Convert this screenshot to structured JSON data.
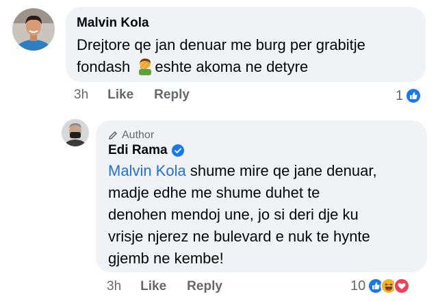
{
  "comment": {
    "author": "Malvin Kola",
    "text_line1": "Drejtore qe jan denuar me burg per grabitje",
    "text_line2_before": "fondash ",
    "text_line2_after": "eshte akoma ne detyre",
    "time": "3h",
    "like_label": "Like",
    "reply_label": "Reply",
    "reaction_count": "1",
    "reaction_icons": [
      "like-icon"
    ]
  },
  "reply": {
    "badge": "Author",
    "author": "Edi Rama",
    "mention": "Malvin Kola",
    "text_line1": " shume mire qe jane denuar,",
    "text_line2": "madje edhe me shume duhet te",
    "text_line3": "denohen mendoj une, jo si deri dje ku",
    "text_line4": "vrisje njerez ne bulevard e nuk te hynte",
    "text_line5": "gjemb ne kembe!",
    "time": "3h",
    "like_label": "Like",
    "reply_label": "Reply",
    "reaction_count": "10",
    "reaction_icons": [
      "like-icon",
      "haha-icon",
      "love-icon"
    ]
  },
  "colors": {
    "bubble": "#f0f2f5",
    "mention": "#216fdb",
    "secondary_text": "#65676b",
    "like_blue": "#1877f2",
    "love_red": "#f33e58",
    "haha_yellow": "#f7b125"
  }
}
